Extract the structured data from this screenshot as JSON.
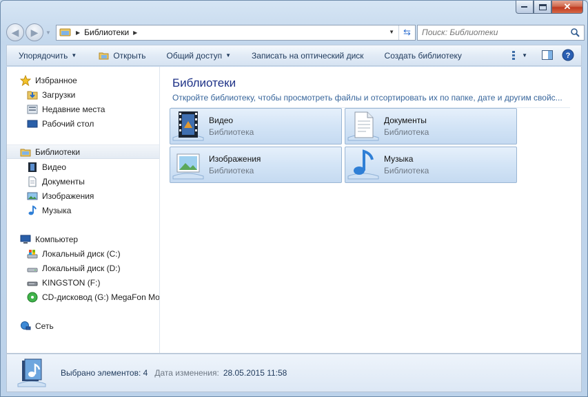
{
  "address": {
    "crumb": "Библиотеки"
  },
  "search": {
    "placeholder": "Поиск: Библиотеки"
  },
  "toolbar": {
    "organize": "Упорядочить",
    "open": "Открыть",
    "share": "Общий доступ",
    "burn": "Записать на оптический диск",
    "new_library": "Создать библиотеку"
  },
  "sidebar": {
    "favorites": "Избранное",
    "downloads": "Загрузки",
    "recent": "Недавние места",
    "desktop": "Рабочий стол",
    "libraries": "Библиотеки",
    "lib_video": "Видео",
    "lib_docs": "Документы",
    "lib_images": "Изображения",
    "lib_music": "Музыка",
    "computer": "Компьютер",
    "drive_c": "Локальный диск (C:)",
    "drive_d": "Локальный диск (D:)",
    "drive_f": "KINGSTON (F:)",
    "drive_g": "CD-дисковод (G:) MegaFon Mo",
    "network": "Сеть"
  },
  "main": {
    "title": "Библиотеки",
    "subtitle": "Откройте библиотеку, чтобы просмотреть файлы и отсортировать их по папке, дате и другим свойс...",
    "tiles": [
      {
        "name": "Видео",
        "type": "Библиотека",
        "icon": "video-library-icon"
      },
      {
        "name": "Документы",
        "type": "Библиотека",
        "icon": "documents-library-icon"
      },
      {
        "name": "Изображения",
        "type": "Библиотека",
        "icon": "images-library-icon"
      },
      {
        "name": "Музыка",
        "type": "Библиотека",
        "icon": "music-library-icon"
      }
    ]
  },
  "details": {
    "selected": "Выбрано элементов: 4",
    "date_label": "Дата изменения:",
    "date_value": "28.05.2015 11:58"
  }
}
